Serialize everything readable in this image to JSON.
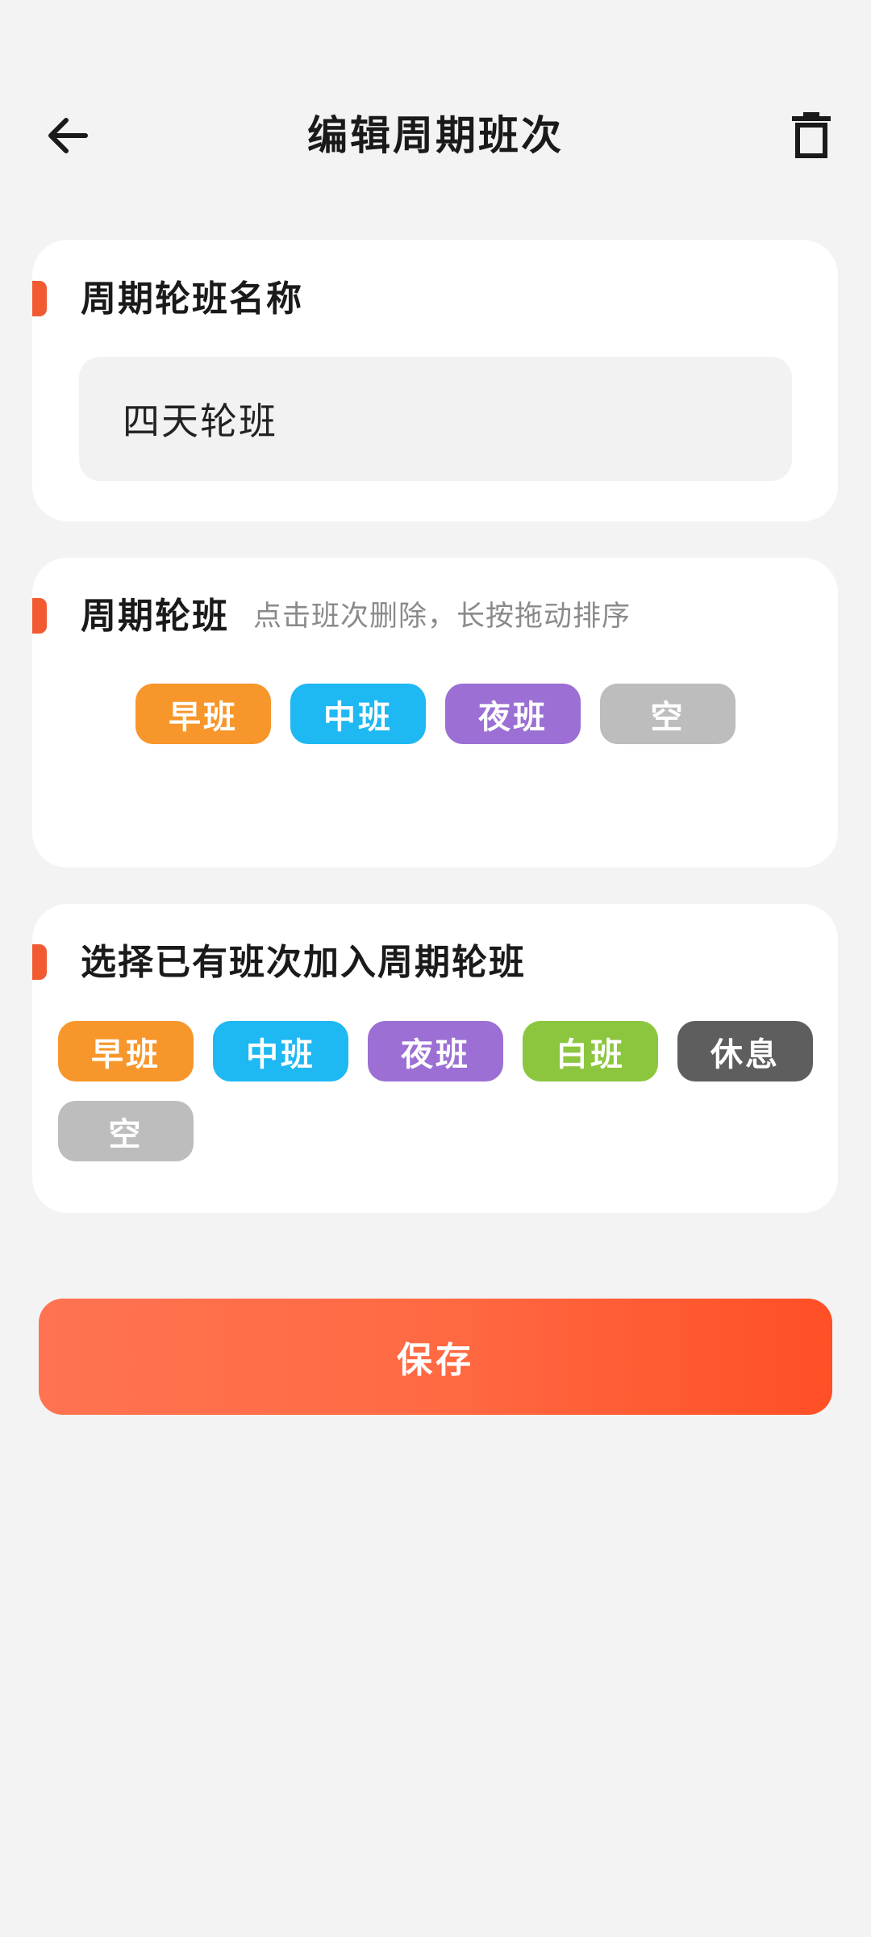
{
  "header": {
    "title": "编辑周期班次",
    "back_icon": "arrow-left-icon",
    "delete_icon": "trash-icon"
  },
  "name_card": {
    "title": "周期轮班名称",
    "input_value": "四天轮班"
  },
  "cycle_card": {
    "title": "周期轮班",
    "hint": "点击班次删除，长按拖动排序",
    "shifts": [
      {
        "label": "早班",
        "color": "#f7962a"
      },
      {
        "label": "中班",
        "color": "#1eb8f2"
      },
      {
        "label": "夜班",
        "color": "#9b6fd3"
      },
      {
        "label": "空",
        "color": "#bdbdbd"
      }
    ]
  },
  "select_card": {
    "title": "选择已有班次加入周期轮班",
    "shifts": [
      {
        "label": "早班",
        "color": "#f7962a"
      },
      {
        "label": "中班",
        "color": "#1eb8f2"
      },
      {
        "label": "夜班",
        "color": "#9b6fd3"
      },
      {
        "label": "白班",
        "color": "#8cc63f"
      },
      {
        "label": "休息",
        "color": "#5e5e5e"
      },
      {
        "label": "空",
        "color": "#bdbdbd"
      }
    ]
  },
  "save_button": {
    "label": "保存"
  },
  "colors": {
    "accent": "#f25a32",
    "background": "#f3f3f3"
  }
}
